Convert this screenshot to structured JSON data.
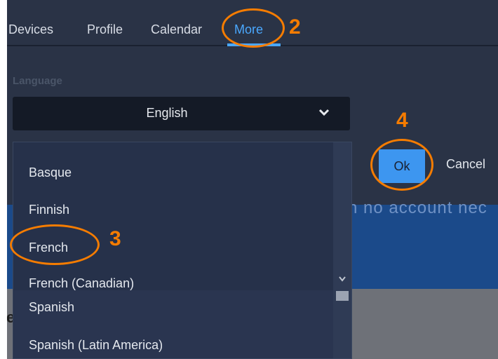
{
  "tabs": [
    {
      "label": "Devices"
    },
    {
      "label": "Profile"
    },
    {
      "label": "Calendar"
    },
    {
      "label": "More",
      "active": true
    }
  ],
  "language": {
    "label": "Language",
    "selected": "English",
    "options": [
      "Basque",
      "Finnish",
      "French",
      "French (Canadian)",
      "Spanish",
      "Spanish (Latin America)"
    ]
  },
  "actions": {
    "ok": "Ok",
    "cancel": "Cancel"
  },
  "background": {
    "partial_text": "n no account nec",
    "partial_text2": "e"
  },
  "annotations": {
    "step2": "2",
    "step3": "3",
    "step4": "4"
  },
  "colors": {
    "panel": "#2a3346",
    "accent": "#4aa8ff",
    "annotation": "#f57c00",
    "ok_button": "#3d96f0"
  }
}
